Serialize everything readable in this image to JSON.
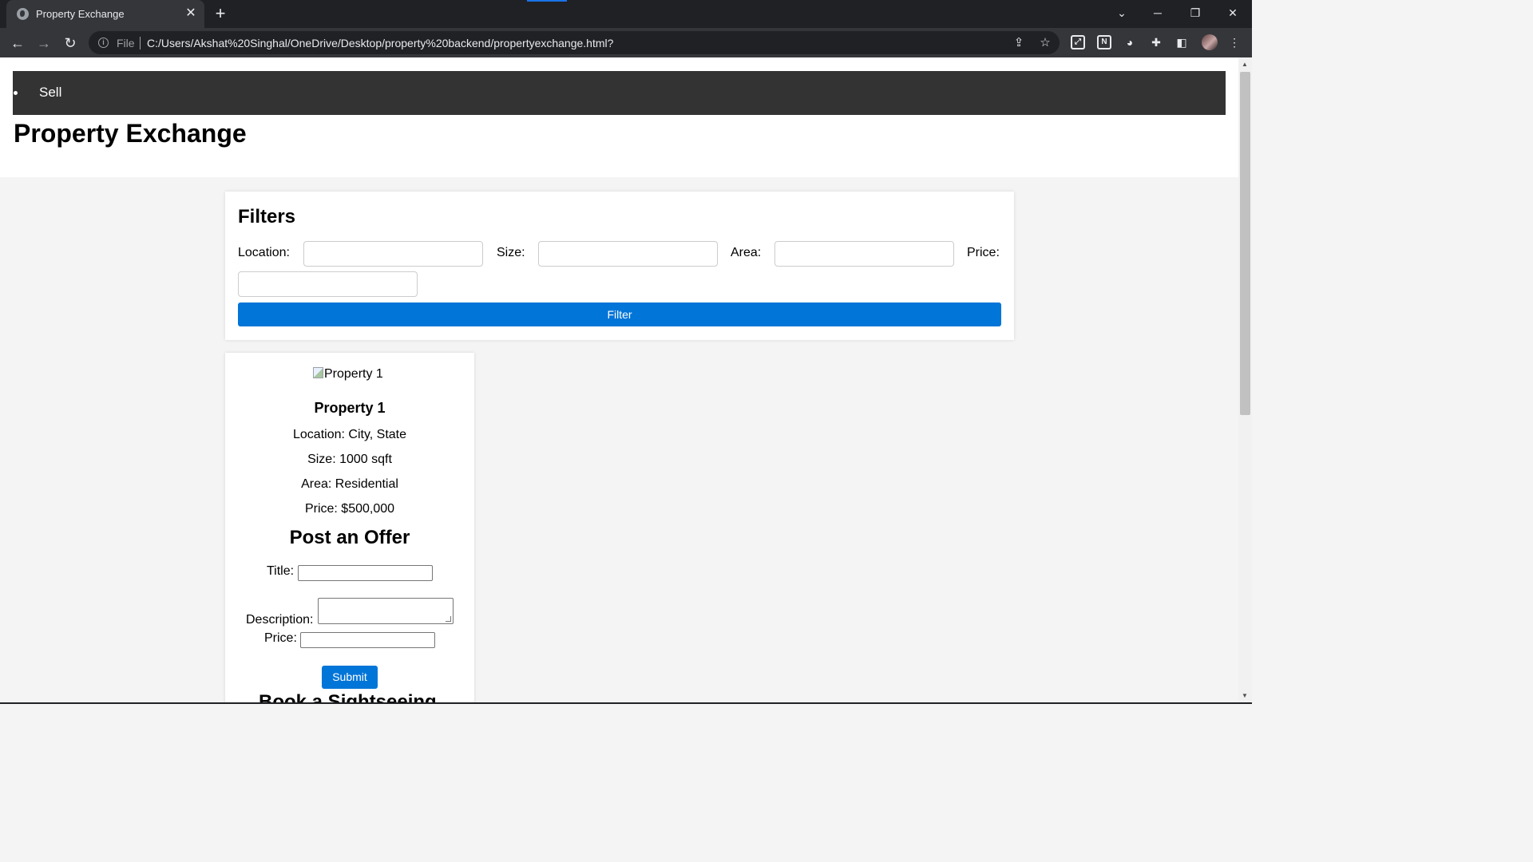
{
  "browser": {
    "tab_title": "Property Exchange",
    "url_scheme": "File",
    "url": "C:/Users/Akshat%20Singhal/OneDrive/Desktop/property%20backend/propertyexchange.html?"
  },
  "nav": {
    "items": [
      {
        "label": "Sell"
      }
    ]
  },
  "site": {
    "title": "Property Exchange"
  },
  "filters": {
    "heading": "Filters",
    "location_label": "Location:",
    "location_value": "",
    "size_label": "Size:",
    "size_value": "",
    "area_label": "Area:",
    "area_value": "",
    "price_label": "Price:",
    "price_value": "",
    "button_label": "Filter"
  },
  "property": {
    "image_alt": "Property 1",
    "name": "Property 1",
    "location": "Location: City, State",
    "size": "Size: 1000 sqft",
    "area": "Area: Residential",
    "price": "Price: $500,000"
  },
  "offer_form": {
    "heading": "Post an Offer",
    "title_label": "Title:",
    "title_value": "",
    "description_label": "Description:",
    "description_value": "",
    "price_label": "Price:",
    "price_value": "",
    "submit_label": "Submit"
  },
  "sightseeing": {
    "heading": "Book a Sightseeing"
  },
  "colors": {
    "navbar": "#333333",
    "accent_button": "#0275d8",
    "page_background": "#f4f4f4"
  }
}
